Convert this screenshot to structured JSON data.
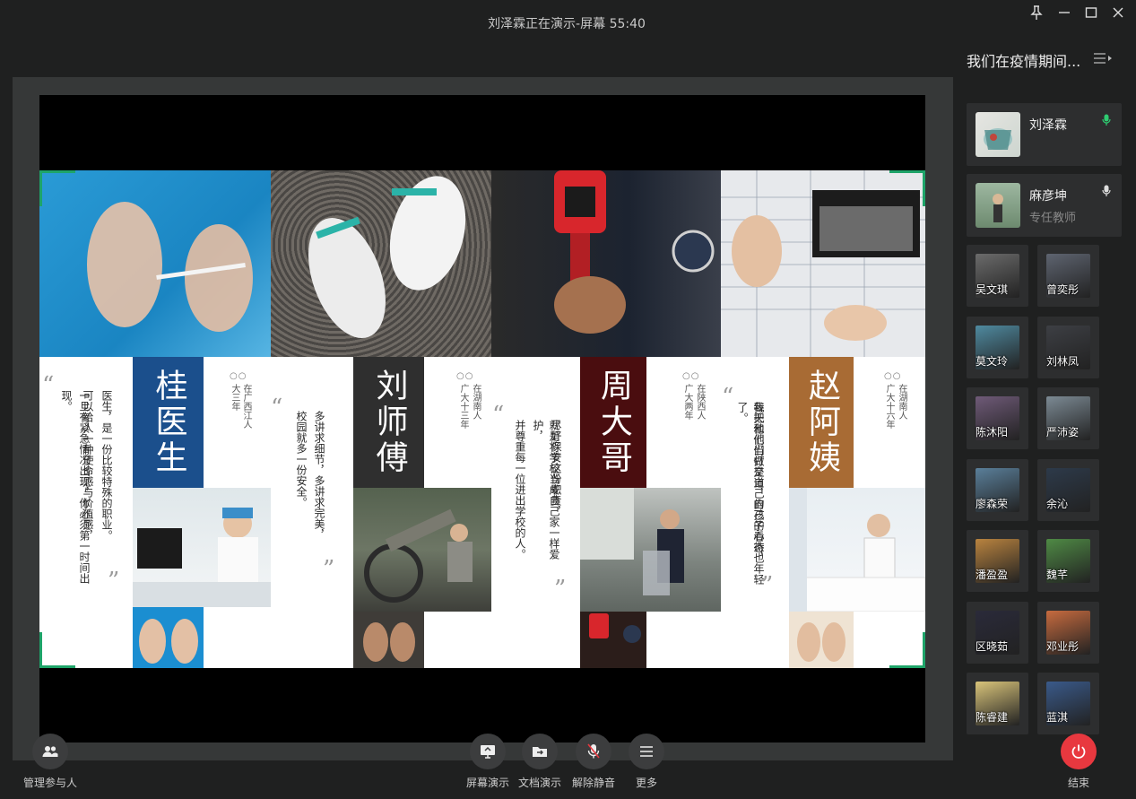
{
  "window": {
    "title": "刘泽霖正在演示-屏幕 55:40",
    "pin_icon": "pin-icon",
    "minimize_icon": "minimize-icon",
    "maximize_icon": "maximize-icon",
    "close_icon": "close-icon"
  },
  "slide": {
    "doctor": {
      "name": "桂医生",
      "origin": "在广西江人",
      "years": "大三年",
      "text1": "医生，是一份比较特殊的职业。",
      "text2": "可以给人一种使命感与价值感，",
      "text3": "一旦有紧急情况出现，你必须第一时间出现。"
    },
    "teacher": {
      "name": "刘师傅",
      "origin": "在湖南人",
      "years": "广大十三年",
      "text1": "多讲求细节，多讲求完美，",
      "text2": "校园就多一份安全。"
    },
    "guard": {
      "name": "周大哥",
      "origin": "在陕西人",
      "years": "广大两年",
      "text1": "尽好保安这份职责，",
      "text2": "就是将学校当成自己家一样爱护，",
      "text3": "并尊重每一位进出学校的人。"
    },
    "aunt": {
      "name": "赵阿姨",
      "origin": "在湖南人",
      "years": "广大十六年",
      "text1": "我把他们当做是自己的孩子看待，",
      "text2": "每天和他们打交道，自己的心态也年轻了。"
    }
  },
  "panel": {
    "title": "我们在疫情期间...",
    "presenter": {
      "name": "刘泽霖",
      "role": ""
    },
    "teacher": {
      "name": "麻彦坤",
      "role": "专任教师"
    },
    "participants": [
      "吴文琪",
      "曾奕彤",
      "莫文玲",
      "刘林凤",
      "陈沐阳",
      "严沛姿",
      "廖森荣",
      "余沁",
      "潘盈盈",
      "魏芊",
      "区晓茹",
      "邓业彤",
      "陈睿建",
      "蓝淇"
    ]
  },
  "toolbar": {
    "manage": "管理参与人",
    "screen_share": "屏幕演示",
    "doc_share": "文档演示",
    "unmute": "解除静音",
    "more": "更多",
    "end": "结束"
  },
  "colors": {
    "accent_green": "#1ea469",
    "end_red": "#e8383f",
    "doctor_blue": "#1b4f8c",
    "teacher_gray": "#2f2f2f",
    "guard_red": "#4a0d0f",
    "aunt_brown": "#a86b34"
  }
}
